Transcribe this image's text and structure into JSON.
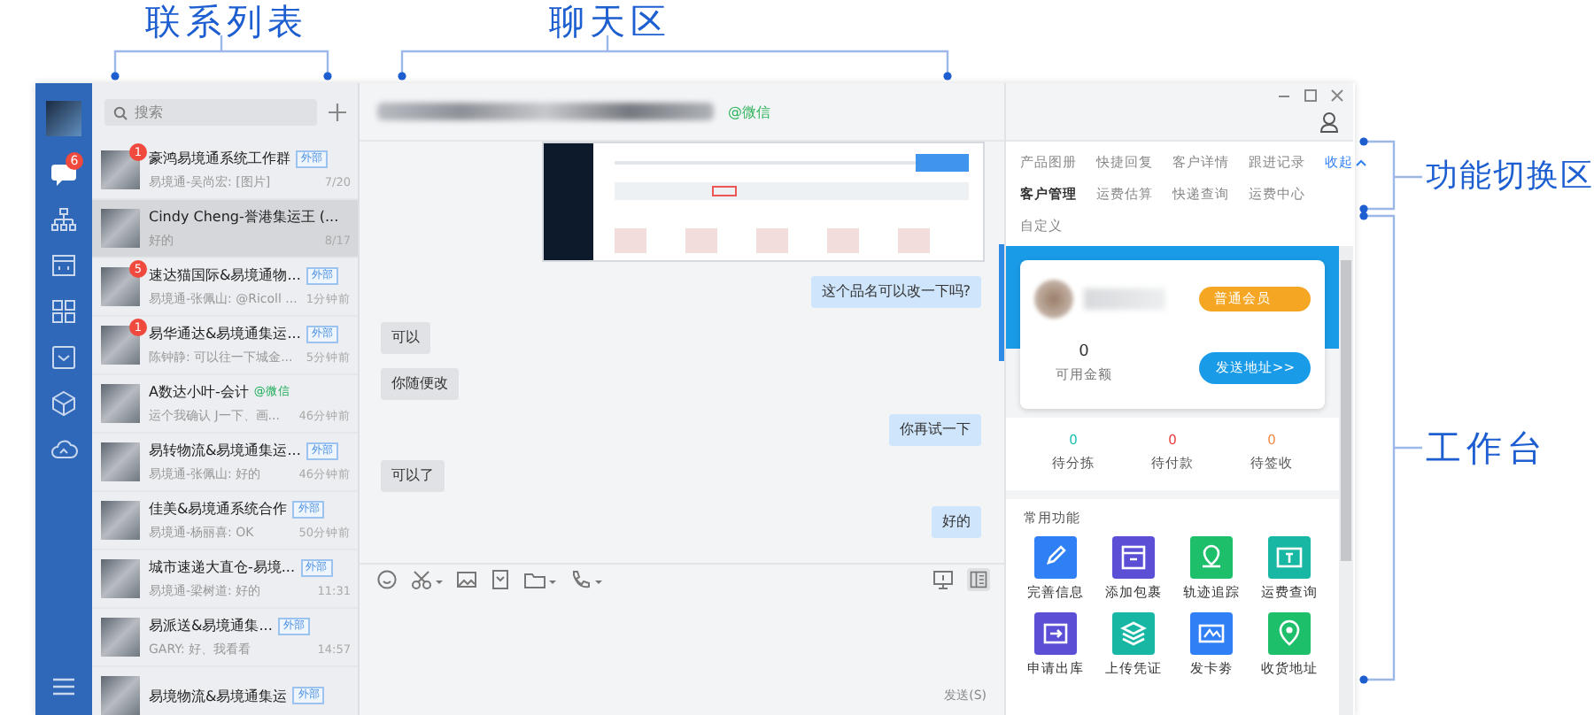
{
  "annotations": [
    {
      "label": "联系列表"
    },
    {
      "label": "聊天区"
    },
    {
      "label": "功能切换区"
    },
    {
      "label": "工作台"
    }
  ],
  "sidebar": {
    "nav": [
      {
        "selected": true,
        "badge": "6"
      },
      {
        "selected": false
      },
      {
        "selected": false
      },
      {
        "selected": false
      },
      {
        "selected": false
      },
      {
        "selected": false
      },
      {
        "selected": false
      }
    ]
  },
  "contacts": {
    "search": {
      "placeholder": "搜索"
    },
    "items": [
      {
        "name": "豪鸿易境通系统工作群",
        "tag": "外部",
        "preview": "易境通-吴尚宏: [图片]",
        "time": "7/20",
        "unread": "1",
        "selected": false
      },
      {
        "name": "Cindy Cheng-誉港集运王 (...",
        "preview": "好的",
        "time": "8/17",
        "selected": true
      },
      {
        "name": "速达猫国际&易境通物...",
        "tag": "外部",
        "preview": "易境通-张佩山: @Ricoll ...",
        "time": "1分钟前",
        "unread": "5",
        "selected": false
      },
      {
        "name": "易华通达&易境通集运...",
        "tag": "外部",
        "preview": "陈钟静: 可以往一下城金...",
        "time": "5分钟前",
        "unread": "1",
        "selected": false
      },
      {
        "name": "A数达小叶-会计",
        "source": "@微信",
        "preview": "运个我确认 J一下、画...",
        "time": "46分钟前",
        "selected": false
      },
      {
        "name": "易转物流&易境通集运...",
        "tag": "外部",
        "preview": "易境通-张佩山: 好的",
        "time": "46分钟前",
        "selected": false
      },
      {
        "name": "佳美&易境通系统合作",
        "tag": "外部",
        "preview": "易境通-杨丽喜: OK",
        "time": "50分钟前",
        "selected": false
      },
      {
        "name": "城市速递大直仓-易境...",
        "tag": "外部",
        "preview": "易境通-梁树道: 好的",
        "time": "11:31",
        "selected": false
      },
      {
        "name": "易派送&易境通集...",
        "tag": "外部",
        "preview": "GARY: 好、我看看",
        "time": "14:57",
        "selected": false
      },
      {
        "name": "易境物流&易境通集运",
        "tag": "外部",
        "selected": false
      }
    ]
  },
  "chat": {
    "status": "@微信",
    "messages": [
      {
        "kind": "image"
      },
      {
        "kind": "sent",
        "text": "这个品名可以改一下吗?"
      },
      {
        "kind": "received",
        "text": "可以"
      },
      {
        "kind": "received",
        "text": "你随便改"
      },
      {
        "kind": "sent",
        "text": "你再试一下"
      },
      {
        "kind": "received",
        "text": "可以了"
      },
      {
        "kind": "sent",
        "text": "好的"
      }
    ],
    "panel_toggle_selected": true,
    "send_label": "发送(S)"
  },
  "workbench": {
    "tabs": [
      {
        "label": "产品图册",
        "selected": false
      },
      {
        "label": "快捷回复",
        "selected": false
      },
      {
        "label": "客户详情",
        "selected": false
      },
      {
        "label": "跟进记录",
        "selected": false
      },
      {
        "label": "客户管理",
        "selected": true
      },
      {
        "label": "运费估算",
        "selected": false
      },
      {
        "label": "快递查询",
        "selected": false
      },
      {
        "label": "运费中心",
        "selected": false
      },
      {
        "label": "自定义",
        "selected": false
      }
    ],
    "collapse_label": "收起",
    "member": {
      "badge": "普通会员",
      "balance": "0",
      "balance_label": "可用金额",
      "button": "发送地址>>"
    },
    "stats": [
      {
        "value": "0",
        "label": "待分拣",
        "color": "#1fc1b3"
      },
      {
        "value": "0",
        "label": "待付款",
        "color": "#e8413c"
      },
      {
        "value": "0",
        "label": "待签收",
        "color": "#f58a4b"
      }
    ],
    "functions": {
      "title": "常用功能",
      "items": [
        {
          "label": "完善信息",
          "color": "#2f7ff5"
        },
        {
          "label": "添加包裹",
          "color": "#5b4fd6"
        },
        {
          "label": "轨迹追踪",
          "color": "#1dbf6a"
        },
        {
          "label": "运费查询",
          "color": "#17b7a4"
        },
        {
          "label": "申请出库",
          "color": "#5b4fd6"
        },
        {
          "label": "上传凭证",
          "color": "#17b7a4"
        },
        {
          "label": "发卡劵",
          "color": "#2f7ff5"
        },
        {
          "label": "收货地址",
          "color": "#1dbf6a"
        }
      ]
    }
  }
}
